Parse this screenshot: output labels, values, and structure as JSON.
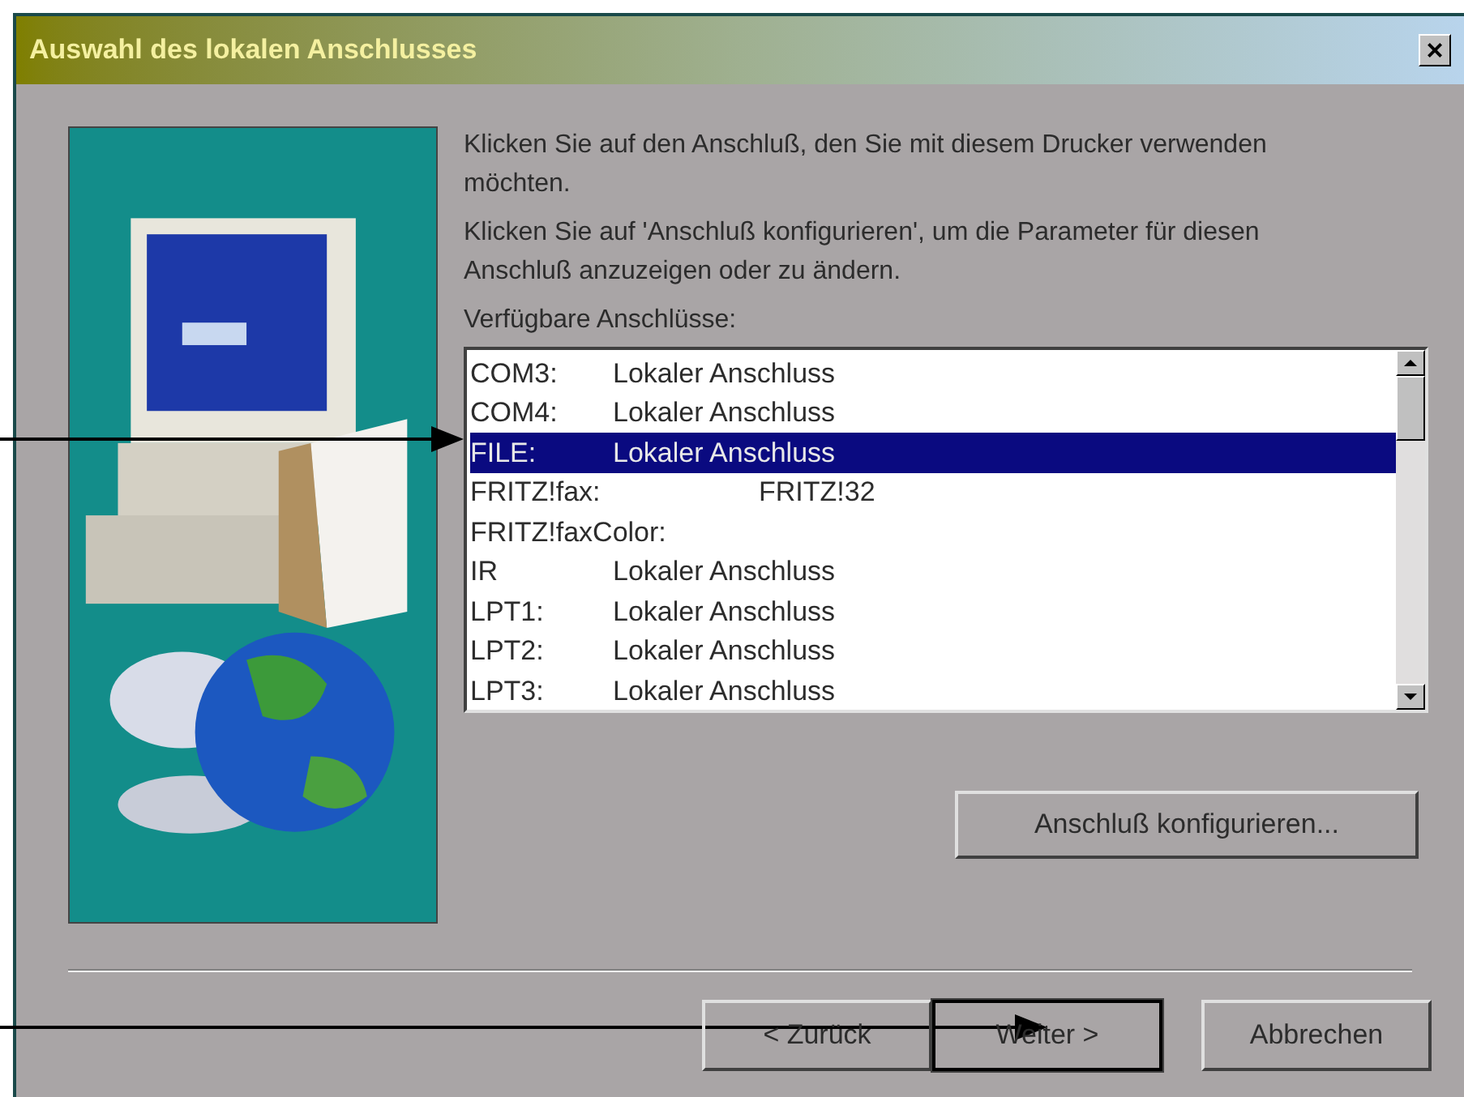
{
  "window": {
    "title": "Auswahl des lokalen Anschlusses",
    "close": "×"
  },
  "instructions": [
    "Klicken Sie auf den Anschluß, den Sie mit diesem Drucker verwenden möchten.",
    "Klicken Sie auf 'Anschluß konfigurieren', um die Parameter für diesen Anschluß anzuzeigen oder zu ändern."
  ],
  "ports_label": "Verfügbare Anschlüsse:",
  "ports": [
    {
      "name": "COM3:",
      "description": "Lokaler Anschluss",
      "selected": false
    },
    {
      "name": "COM4:",
      "description": "Lokaler Anschluss",
      "selected": false
    },
    {
      "name": "FILE:",
      "description": "Lokaler Anschluss",
      "selected": true
    },
    {
      "name": "FRITZ!fax:",
      "description": "FRITZ!32",
      "selected": false
    },
    {
      "name": "FRITZ!faxColor:",
      "selected": false
    },
    {
      "name": "IR",
      "description": "Lokaler Anschluss",
      "selected": false
    },
    {
      "name": "LPT1:",
      "description": "Lokaler Anschluss",
      "selected": false
    },
    {
      "name": "LPT2:",
      "description": "Lokaler Anschluss",
      "selected": false
    },
    {
      "name": "LPT3:",
      "description": "Lokaler Anschluss",
      "selected": false
    }
  ],
  "configure_button": "Anschluß konfigurieren...",
  "buttons": [
    {
      "label": "< Zurück",
      "default": false
    },
    {
      "label": "Weiter >",
      "default": true
    },
    {
      "label": "Abbrechen",
      "default": false
    }
  ]
}
